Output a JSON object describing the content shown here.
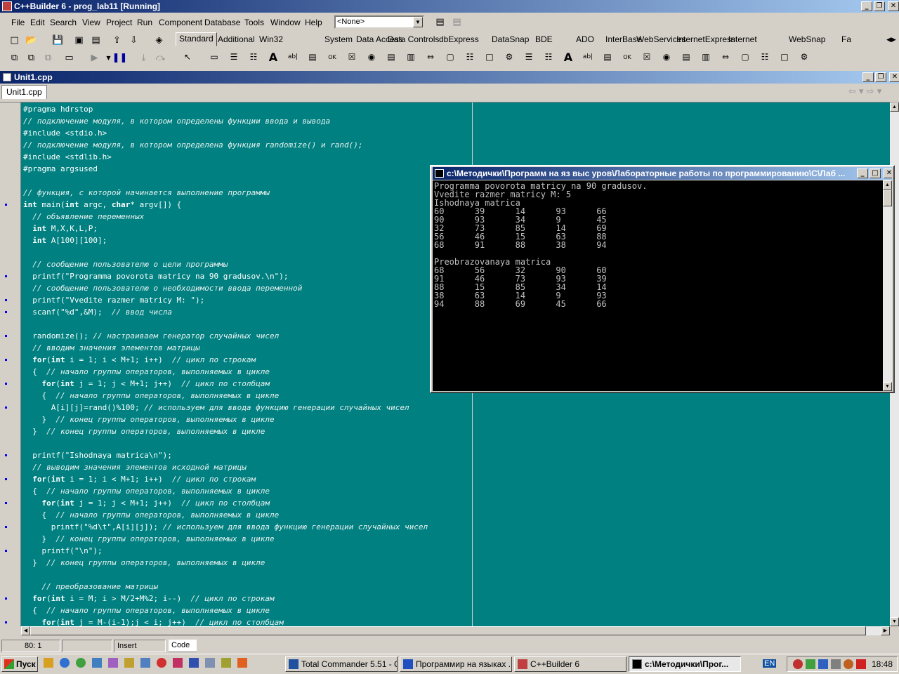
{
  "app": {
    "title": "C++Builder 6 - prog_lab11 [Running]"
  },
  "menu": [
    "File",
    "Edit",
    "Search",
    "View",
    "Project",
    "Run",
    "Component",
    "Database",
    "Tools",
    "Window",
    "Help"
  ],
  "combo_value": "<None>",
  "palette_tabs": [
    "Standard",
    "Additional",
    "Win32",
    "System",
    "Data Access",
    "Data Controls",
    "dbExpress",
    "DataSnap",
    "BDE",
    "ADO",
    "InterBase",
    "WebServices",
    "InternetExpress",
    "Internet",
    "WebSnap",
    "Fa"
  ],
  "editor": {
    "title": "Unit1.cpp",
    "file_tab": "Unit1.cpp"
  },
  "code_lines": [
    "#pragma hdrstop",
    "// подключение модуля, в котором определены функции ввода и вывода",
    "#include <stdio.h>",
    "// подключение модуля, в котором определена функция randomize() и rand();",
    "#include <stdlib.h>",
    "#pragma argsused",
    "",
    "// функция, с которой начинается выполнение программы",
    "int main(int argc, char* argv[]) {",
    "  // объявление переменных",
    "  int M,X,K,L,P;",
    "  int A[100][100];",
    "",
    "  // сообщение пользователю о цели программы",
    "  printf(\"Programma povorota matricy na 90 gradusov.\\n\");",
    "  // сообщение пользователю о необходимости ввода переменной",
    "  printf(\"Vvedite razmer matricy M: \");",
    "  scanf(\"%d\",&M);  // ввод числа",
    "",
    "  randomize(); // настраиваем генератор случайных чисел",
    "  // вводим значения элементов матрицы",
    "  for(int i = 1; i < M+1; i++)  // цикл по строкам",
    "  {  // начало группы операторов, выполняемых в цикле",
    "    for(int j = 1; j < M+1; j++)  // цикл по столбцам",
    "    {  // начало группы операторов, выполняемых в цикле",
    "      A[i][j]=rand()%100; // используем для ввода функцию генерации случайных чисел",
    "    }  // конец группы операторов, выполняемых в цикле",
    "  }  // конец группы операторов, выполняемых в цикле",
    "",
    "  printf(\"Ishodnaya matrica\\n\");",
    "  // выводим значения элементов исходной матрицы",
    "  for(int i = 1; i < M+1; i++)  // цикл по строкам",
    "  {  // начало группы операторов, выполняемых в цикле",
    "    for(int j = 1; j < M+1; j++)  // цикл по столбцам",
    "    {  // начало группы операторов, выполняемых в цикле",
    "      printf(\"%d\\t\",A[i][j]); // используем для ввода функцию генерации случайных чисел",
    "    }  // конец группы операторов, выполняемых в цикле",
    "    printf(\"\\n\");",
    "  }  // конец группы операторов, выполняемых в цикле",
    "",
    "    // преобразование матрицы",
    "  for(int i = M; i > M/2+M%2; i--)  // цикл по строкам",
    "  {  // начало группы операторов, выполняемых в цикле",
    "    for(int j = M-(i-1);j < i; j++)  // цикл по столбцам"
  ],
  "breakpoint_lines": [
    8,
    14,
    16,
    17,
    19,
    21,
    23,
    25,
    29,
    31,
    33,
    35,
    37,
    41,
    43
  ],
  "console": {
    "title": "c:\\Методички\\Программ на яз выс уров\\Лабораторные работы по программированию\\С\\Лаб ...",
    "lines": [
      "Programma povorota matricy na 90 gradusov.",
      "Vvedite razmer matricy M: 5",
      "Ishodnaya matrica",
      "60      39      14      93      66",
      "90      93      34      9       45",
      "32      73      85      14      69",
      "56      46      15      63      88",
      "68      91      88      38      94",
      "",
      "Preobrazovanaya matrica",
      "68      56      32      90      60",
      "91      46      73      93      39",
      "88      15      85      34      14",
      "38      63      14      9       93",
      "94      88      69      45      66"
    ]
  },
  "status": {
    "position": "80:  1",
    "mode": "Insert",
    "tab": "Code"
  },
  "taskbar": {
    "start": "Пуск",
    "buttons": [
      "Total Commander 5.51 - C...",
      "Программир на языках ...",
      "C++Builder 6",
      "c:\\Методички\\Прог..."
    ],
    "lang": "EN",
    "clock": "18:48"
  },
  "colors": {
    "editor_bg": "#008080",
    "titlebar": "#0a246a",
    "console_bg": "#000000"
  }
}
